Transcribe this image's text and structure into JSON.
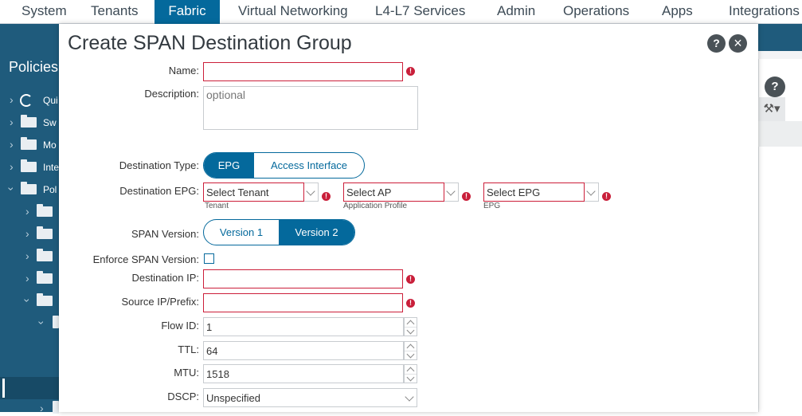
{
  "topnav": {
    "tabs": [
      "System",
      "Tenants",
      "Fabric",
      "Virtual Networking",
      "L4-L7 Services",
      "Admin",
      "Operations",
      "Apps",
      "Integrations"
    ],
    "active": "Fabric"
  },
  "sidebar": {
    "title": "Policies",
    "items": [
      "Qui",
      "Sw",
      "Mo",
      "Inte",
      "Pol"
    ]
  },
  "modal": {
    "title": "Create SPAN Destination Group",
    "help_icon": "?",
    "close_icon": "×",
    "fields": {
      "name": {
        "label": "Name:",
        "value": "",
        "required": true
      },
      "description": {
        "label": "Description:",
        "placeholder": "optional"
      },
      "destination_type": {
        "label": "Destination Type:",
        "options": [
          "EPG",
          "Access Interface"
        ],
        "selected": "EPG"
      },
      "destination_epg": {
        "label": "Destination EPG:",
        "tenant": {
          "placeholder": "Select Tenant",
          "sublabel": "Tenant"
        },
        "ap": {
          "placeholder": "Select AP",
          "sublabel": "Application Profile"
        },
        "epg": {
          "placeholder": "Select EPG",
          "sublabel": "EPG"
        }
      },
      "span_version": {
        "label": "SPAN Version:",
        "options": [
          "Version 1",
          "Version 2"
        ],
        "selected": "Version 2"
      },
      "enforce_span_version": {
        "label": "Enforce SPAN Version:",
        "checked": false
      },
      "destination_ip": {
        "label": "Destination IP:",
        "value": ""
      },
      "source_ip_prefix": {
        "label": "Source IP/Prefix:",
        "value": ""
      },
      "flow_id": {
        "label": "Flow ID:",
        "value": "1"
      },
      "ttl": {
        "label": "TTL:",
        "value": "64"
      },
      "mtu": {
        "label": "MTU:",
        "value": "1518"
      },
      "dscp": {
        "label": "DSCP:",
        "value": "Unspecified"
      }
    }
  },
  "right_panel": {
    "help_icon": "?",
    "tool_icon": "⚒▾"
  },
  "colors": {
    "accent": "#04699c",
    "nav_dark": "#1f5b7c",
    "error": "#cc1f3a"
  }
}
